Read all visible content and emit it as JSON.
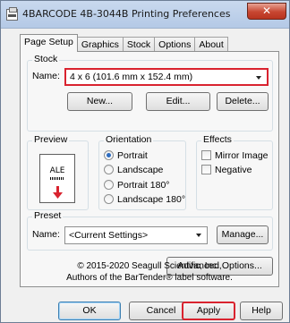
{
  "window": {
    "title": "4BARCODE 4B-3044B Printing Preferences",
    "close_label": "✕"
  },
  "tabs": [
    {
      "label": "Page Setup",
      "active": true
    },
    {
      "label": "Graphics",
      "active": false
    },
    {
      "label": "Stock",
      "active": false
    },
    {
      "label": "Options",
      "active": false
    },
    {
      "label": "About",
      "active": false
    }
  ],
  "stock": {
    "group_label": "Stock",
    "name_label": "Name:",
    "name_value": "4 x 6 (101.6 mm x 152.4 mm)",
    "new_button": "New...",
    "edit_button": "Edit...",
    "delete_button": "Delete..."
  },
  "preview": {
    "group_label": "Preview",
    "label_text": "ALE"
  },
  "orientation": {
    "group_label": "Orientation",
    "options": [
      {
        "label": "Portrait",
        "checked": true
      },
      {
        "label": "Landscape",
        "checked": false
      },
      {
        "label": "Portrait 180°",
        "checked": false
      },
      {
        "label": "Landscape 180°",
        "checked": false
      }
    ]
  },
  "effects": {
    "group_label": "Effects",
    "options": [
      {
        "label": "Mirror Image",
        "checked": false
      },
      {
        "label": "Negative",
        "checked": false
      }
    ]
  },
  "preset": {
    "group_label": "Preset",
    "name_label": "Name:",
    "name_value": "<Current Settings>",
    "manage_button": "Manage..."
  },
  "advanced_button": "Advanced Options...",
  "copyright": {
    "line1": "© 2015-2020 Seagull Scientific, Inc.,",
    "line2": "Authors of the BarTender® label software."
  },
  "footer": {
    "ok": "OK",
    "cancel": "Cancel",
    "apply": "Apply",
    "help": "Help"
  },
  "colors": {
    "highlight": "#d9232f",
    "radio_selected": "#2e6cc0"
  }
}
